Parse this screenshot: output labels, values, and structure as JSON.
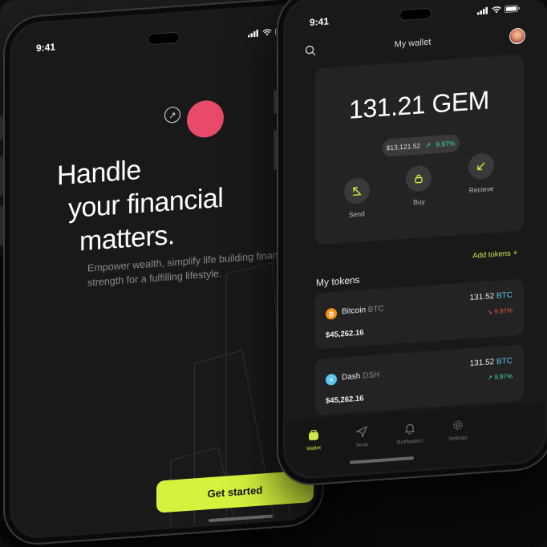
{
  "left_phone": {
    "status_time": "9:41",
    "hero_title_lines": [
      "Handle",
      "your financial",
      "matters."
    ],
    "hero_subtitle_lines": [
      "Empower wealth, simplify life building financial",
      "strength for a fulfilling lifestyle."
    ],
    "cta_label": "Get started",
    "arrow_icon": "arrow-up-right-icon",
    "accent_pink": "#e84a6a",
    "accent_lime": "#d6f23e"
  },
  "right_phone": {
    "status_time": "9:41",
    "header_title": "My wallet",
    "balance": {
      "amount": "131.21 GEM",
      "usd": "$13,121.52",
      "change": "9.97%"
    },
    "actions": [
      {
        "label": "Send",
        "icon": "arrow-up-left-icon"
      },
      {
        "label": "Buy",
        "icon": "lock-icon"
      },
      {
        "label": "Recieve",
        "icon": "arrow-down-left-icon"
      }
    ],
    "add_tokens_label": "Add tokens",
    "my_tokens_label": "My tokens",
    "tokens": [
      {
        "name": "Bitcoin",
        "symbol": "BTC",
        "amount": "131.52",
        "amount_symbol": "BTC",
        "change": "9.97%",
        "trend": "down",
        "usd": "$45,262.16",
        "icon_color": "#f7931a"
      },
      {
        "name": "Dash",
        "symbol": "DSH",
        "amount": "131.52",
        "amount_symbol": "BTC",
        "change": "9.97%",
        "trend": "up",
        "usd": "$45,262.16",
        "icon_color": "#5ac8f0"
      }
    ],
    "tabs": [
      {
        "label": "Wallet",
        "icon": "wallet-icon",
        "active": true
      },
      {
        "label": "Send",
        "icon": "send-icon",
        "active": false
      },
      {
        "label": "Notification",
        "icon": "bell-icon",
        "active": false
      },
      {
        "label": "Settings",
        "icon": "gear-icon",
        "active": false
      }
    ]
  }
}
